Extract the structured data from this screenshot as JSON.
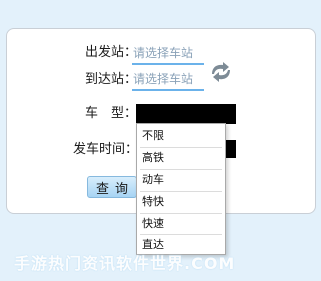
{
  "form": {
    "from_label": "出发站：",
    "from_placeholder": "请选择车站",
    "to_label": "到达站：",
    "to_placeholder": "请选择车站",
    "type_label": "车　型：",
    "time_label": "发车时间：",
    "query_label": "查询"
  },
  "train_type_options": [
    "不限",
    "高铁",
    "动车",
    "特快",
    "快速",
    "直达"
  ],
  "watermark": "手游热门资讯软件世界.COM",
  "colors": {
    "accent_underline": "#6bb2ea",
    "swap_icon": "#7d8b96",
    "background": "#e3f1fb"
  },
  "icons": {
    "swap": "swap-arrows-icon"
  }
}
